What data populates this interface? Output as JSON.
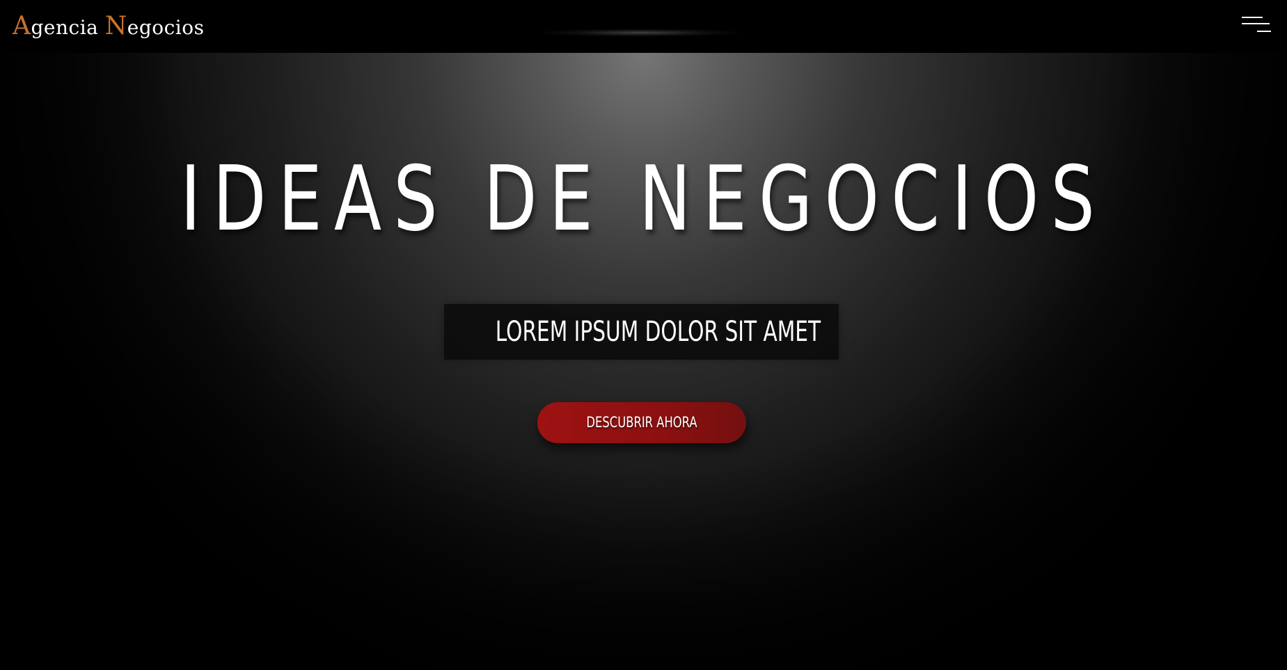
{
  "brand": {
    "prefix_initial": "A",
    "prefix_rest": "gencia ",
    "suffix_initial": "N",
    "suffix_rest": "egocios",
    "accent_color": "#c8742a"
  },
  "header": {
    "menu_icon": "hamburger-menu-icon"
  },
  "hero": {
    "title": "IDEAS DE NEGOCIOS",
    "subtitle": "LOREM IPSUM DOLOR SIT AMET",
    "cta_label": "DESCUBRIR AHORA",
    "cta_color": "#9e1212"
  }
}
